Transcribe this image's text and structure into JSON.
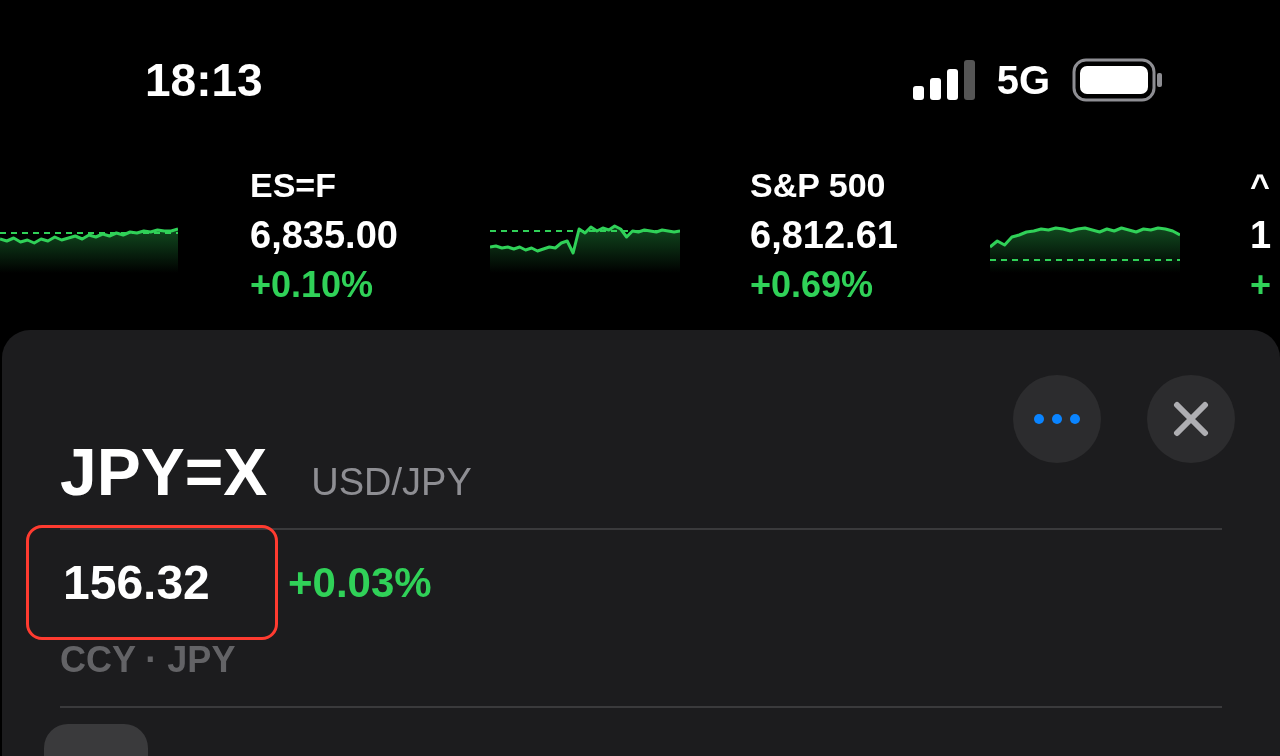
{
  "status_bar": {
    "time": "18:13",
    "network": "5G"
  },
  "tickers": [
    {
      "symbol": "ES=F",
      "price": "6,835.00",
      "change": "+0.10%"
    },
    {
      "symbol": "S&P 500",
      "price": "6,812.61",
      "change": "+0.69%"
    },
    {
      "symbol": "^",
      "price": "1",
      "change": "+"
    }
  ],
  "quote": {
    "symbol": "JPY=X",
    "name": "USD/JPY",
    "price": "156.32",
    "change": "+0.03%",
    "exchange": "CCY · JPY",
    "price_highlighted": true
  }
}
